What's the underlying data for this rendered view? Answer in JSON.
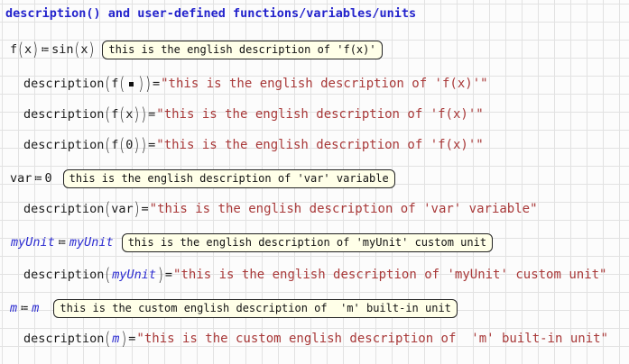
{
  "palette": {
    "title_blue": "#2323CC",
    "variable_blue": "#2B2BD0",
    "string_red": "#A83838",
    "box_background": "#FFFFE8",
    "grid_line": "#E2E2E2",
    "canvas_background": "#FCFCFC",
    "math_black": "#1A1A1A"
  },
  "title": {
    "text": "description() and user-defined functions/variables/units"
  },
  "rows": [
    {
      "name": "f-function-definition",
      "kind": "definition",
      "math": [
        {
          "s": "id",
          "t": "f"
        },
        {
          "s": "lp",
          "t": "("
        },
        {
          "s": "id",
          "t": "x"
        },
        {
          "s": "rp",
          "t": ")"
        },
        {
          "s": "op",
          "t": "≔"
        },
        {
          "s": "id",
          "t": "sin"
        },
        {
          "s": "lp",
          "t": "("
        },
        {
          "s": "id",
          "t": "x"
        },
        {
          "s": "rp",
          "t": ")"
        }
      ],
      "box": "this is the english description of 'f(x)'"
    },
    {
      "name": "description-of-f-placeholder",
      "kind": "evaluation",
      "math": [
        {
          "s": "id",
          "t": "description"
        },
        {
          "s": "lp",
          "t": "("
        },
        {
          "s": "id",
          "t": "f"
        },
        {
          "s": "lp",
          "t": "("
        },
        {
          "s": "ph",
          "t": ""
        },
        {
          "s": "rp",
          "t": ")"
        },
        {
          "s": "rp",
          "t": ")"
        },
        {
          "s": "eq",
          "t": "="
        },
        {
          "s": "str",
          "t": "\"this is the english description of 'f(x)'\""
        }
      ]
    },
    {
      "name": "description-of-f-x",
      "kind": "evaluation",
      "math": [
        {
          "s": "id",
          "t": "description"
        },
        {
          "s": "lp",
          "t": "("
        },
        {
          "s": "id",
          "t": "f"
        },
        {
          "s": "lp",
          "t": "("
        },
        {
          "s": "id",
          "t": "x"
        },
        {
          "s": "rp",
          "t": ")"
        },
        {
          "s": "rp",
          "t": ")"
        },
        {
          "s": "eq",
          "t": "="
        },
        {
          "s": "str",
          "t": "\"this is the english description of 'f(x)'\""
        }
      ]
    },
    {
      "name": "description-of-f-0",
      "kind": "evaluation",
      "math": [
        {
          "s": "id",
          "t": "description"
        },
        {
          "s": "lp",
          "t": "("
        },
        {
          "s": "id",
          "t": "f"
        },
        {
          "s": "lp",
          "t": "("
        },
        {
          "s": "num",
          "t": "0"
        },
        {
          "s": "rp",
          "t": ")"
        },
        {
          "s": "rp",
          "t": ")"
        },
        {
          "s": "eq",
          "t": "="
        },
        {
          "s": "str",
          "t": "\"this is the english description of 'f(x)'\""
        }
      ]
    },
    {
      "name": "var-definition",
      "kind": "definition",
      "math": [
        {
          "s": "id",
          "t": "var"
        },
        {
          "s": "op",
          "t": "≔"
        },
        {
          "s": "num",
          "t": "0"
        }
      ],
      "box": "this is the english description of 'var' variable"
    },
    {
      "name": "description-of-var",
      "kind": "evaluation",
      "math": [
        {
          "s": "id",
          "t": "description"
        },
        {
          "s": "lp",
          "t": "("
        },
        {
          "s": "id",
          "t": "var"
        },
        {
          "s": "rp",
          "t": ")"
        },
        {
          "s": "eq",
          "t": "="
        },
        {
          "s": "str",
          "t": "\"this is the english description of 'var' variable\""
        }
      ]
    },
    {
      "name": "myunit-definition",
      "kind": "definition",
      "math": [
        {
          "s": "unit",
          "t": "myUnit"
        },
        {
          "s": "op",
          "t": "≔"
        },
        {
          "s": "unit",
          "t": "myUnit"
        }
      ],
      "box": "this is the english description of 'myUnit' custom unit"
    },
    {
      "name": "description-of-myunit",
      "kind": "evaluation",
      "math": [
        {
          "s": "id",
          "t": "description"
        },
        {
          "s": "lp",
          "t": "("
        },
        {
          "s": "unit",
          "t": "myUnit"
        },
        {
          "s": "rp",
          "t": ")"
        },
        {
          "s": "eq",
          "t": "="
        },
        {
          "s": "str",
          "t": "\"this is the english description of 'myUnit' custom unit\""
        }
      ]
    },
    {
      "name": "m-unit-definition",
      "kind": "definition",
      "math": [
        {
          "s": "unit",
          "t": "m"
        },
        {
          "s": "op",
          "t": "≔"
        },
        {
          "s": "unit",
          "t": "m"
        }
      ],
      "box": "this is the custom english description of  'm' built-in unit"
    },
    {
      "name": "description-of-m",
      "kind": "evaluation",
      "math": [
        {
          "s": "id",
          "t": "description"
        },
        {
          "s": "lp",
          "t": "("
        },
        {
          "s": "unit",
          "t": "m"
        },
        {
          "s": "rp",
          "t": ")"
        },
        {
          "s": "eq",
          "t": "="
        },
        {
          "s": "str",
          "t": "\"this is the custom english description of  'm' built-in unit\""
        }
      ]
    }
  ]
}
